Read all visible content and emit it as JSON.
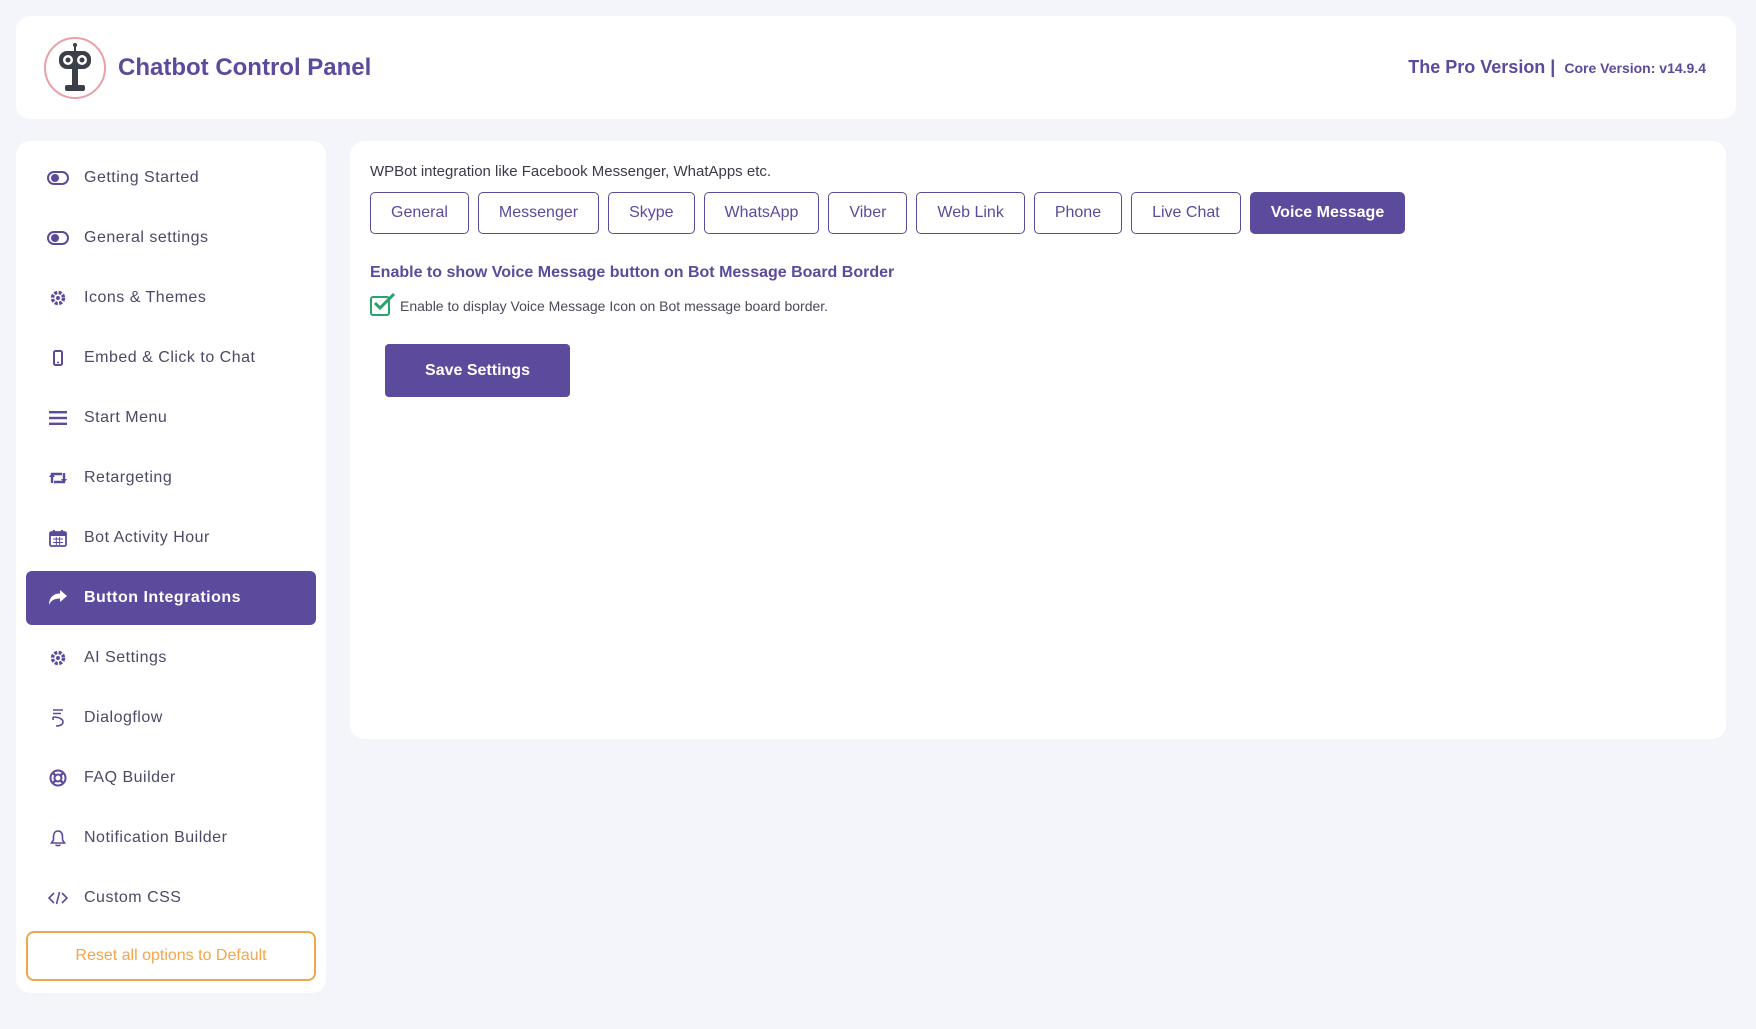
{
  "header": {
    "title": "Chatbot Control Panel",
    "logo_icon": "robot-logo-icon",
    "version_label": "The Pro Version |",
    "core_version": "Core Version: v14.9.4"
  },
  "colors": {
    "accent": "#5c4a9c",
    "warning": "#f2a54a",
    "success": "#2aa36b"
  },
  "sidebar": {
    "items": [
      {
        "label": "Getting Started",
        "icon": "toggle-icon"
      },
      {
        "label": "General settings",
        "icon": "toggle-icon"
      },
      {
        "label": "Icons & Themes",
        "icon": "gear-icon"
      },
      {
        "label": "Embed & Click to Chat",
        "icon": "mobile-icon"
      },
      {
        "label": "Start Menu",
        "icon": "menu-icon"
      },
      {
        "label": "Retargeting",
        "icon": "retweet-icon"
      },
      {
        "label": "Bot Activity Hour",
        "icon": "calendar-icon"
      },
      {
        "label": "Button Integrations",
        "icon": "share-icon",
        "active": true
      },
      {
        "label": "AI Settings",
        "icon": "gear-icon"
      },
      {
        "label": "Dialogflow",
        "icon": "dialogflow-icon"
      },
      {
        "label": "FAQ Builder",
        "icon": "lifebuoy-icon"
      },
      {
        "label": "Notification Builder",
        "icon": "bell-icon"
      },
      {
        "label": "Custom CSS",
        "icon": "code-icon"
      }
    ],
    "reset_label": "Reset all options to Default"
  },
  "main": {
    "intro": "WPBot integration like Facebook Messenger, WhatApps etc.",
    "tabs": [
      {
        "label": "General"
      },
      {
        "label": "Messenger"
      },
      {
        "label": "Skype"
      },
      {
        "label": "WhatsApp"
      },
      {
        "label": "Viber"
      },
      {
        "label": "Web Link"
      },
      {
        "label": "Phone"
      },
      {
        "label": "Live Chat"
      },
      {
        "label": "Voice Message",
        "active": true
      }
    ],
    "section_title": "Enable to show Voice Message button on Bot Message Board Border",
    "checkbox_label": "Enable to display Voice Message Icon on Bot message board border.",
    "checkbox_checked": true,
    "save_label": "Save Settings"
  }
}
